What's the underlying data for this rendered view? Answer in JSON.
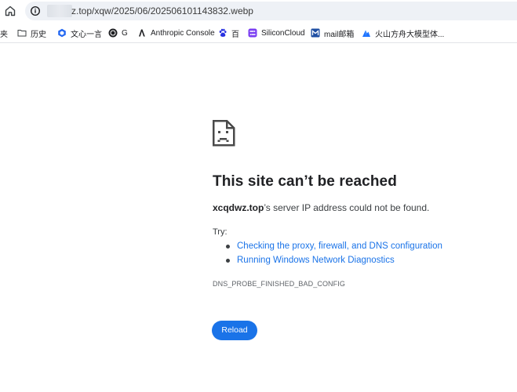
{
  "address_bar": {
    "url": "z.top/xqw/2025/06/20250610114383​2.webp"
  },
  "bookmarks": [
    {
      "label": "夹",
      "icon": "bookmark-partial"
    },
    {
      "label": "历史",
      "icon": "folder-icon"
    },
    {
      "label": "文心一言",
      "icon": "wenxin-icon"
    },
    {
      "label": "G",
      "icon": "chatgpt-icon"
    },
    {
      "label": "Anthropic Console",
      "icon": "anthropic-icon"
    },
    {
      "label": "百",
      "icon": "baidu-paw-icon"
    },
    {
      "label": "SiliconCloud",
      "icon": "siliconcloud-icon"
    },
    {
      "label": "mail邮箱",
      "icon": "mail-icon"
    },
    {
      "label": "火山方舟大模型体...",
      "icon": "volcano-icon"
    }
  ],
  "error": {
    "title": "This site can’t be reached",
    "host": "xcqdwz.top",
    "desc_rest": "’s server IP address could not be found.",
    "try_label": "Try:",
    "suggestions": [
      "Checking the proxy, firewall, and DNS configuration",
      "Running Windows Network Diagnostics"
    ],
    "code": "DNS_PROBE_FINISHED_BAD_CONFIG",
    "reload_label": "Reload"
  },
  "colors": {
    "link": "#1a73e8",
    "button": "#1a73e8",
    "omnibox_bg": "#eef1f6"
  }
}
